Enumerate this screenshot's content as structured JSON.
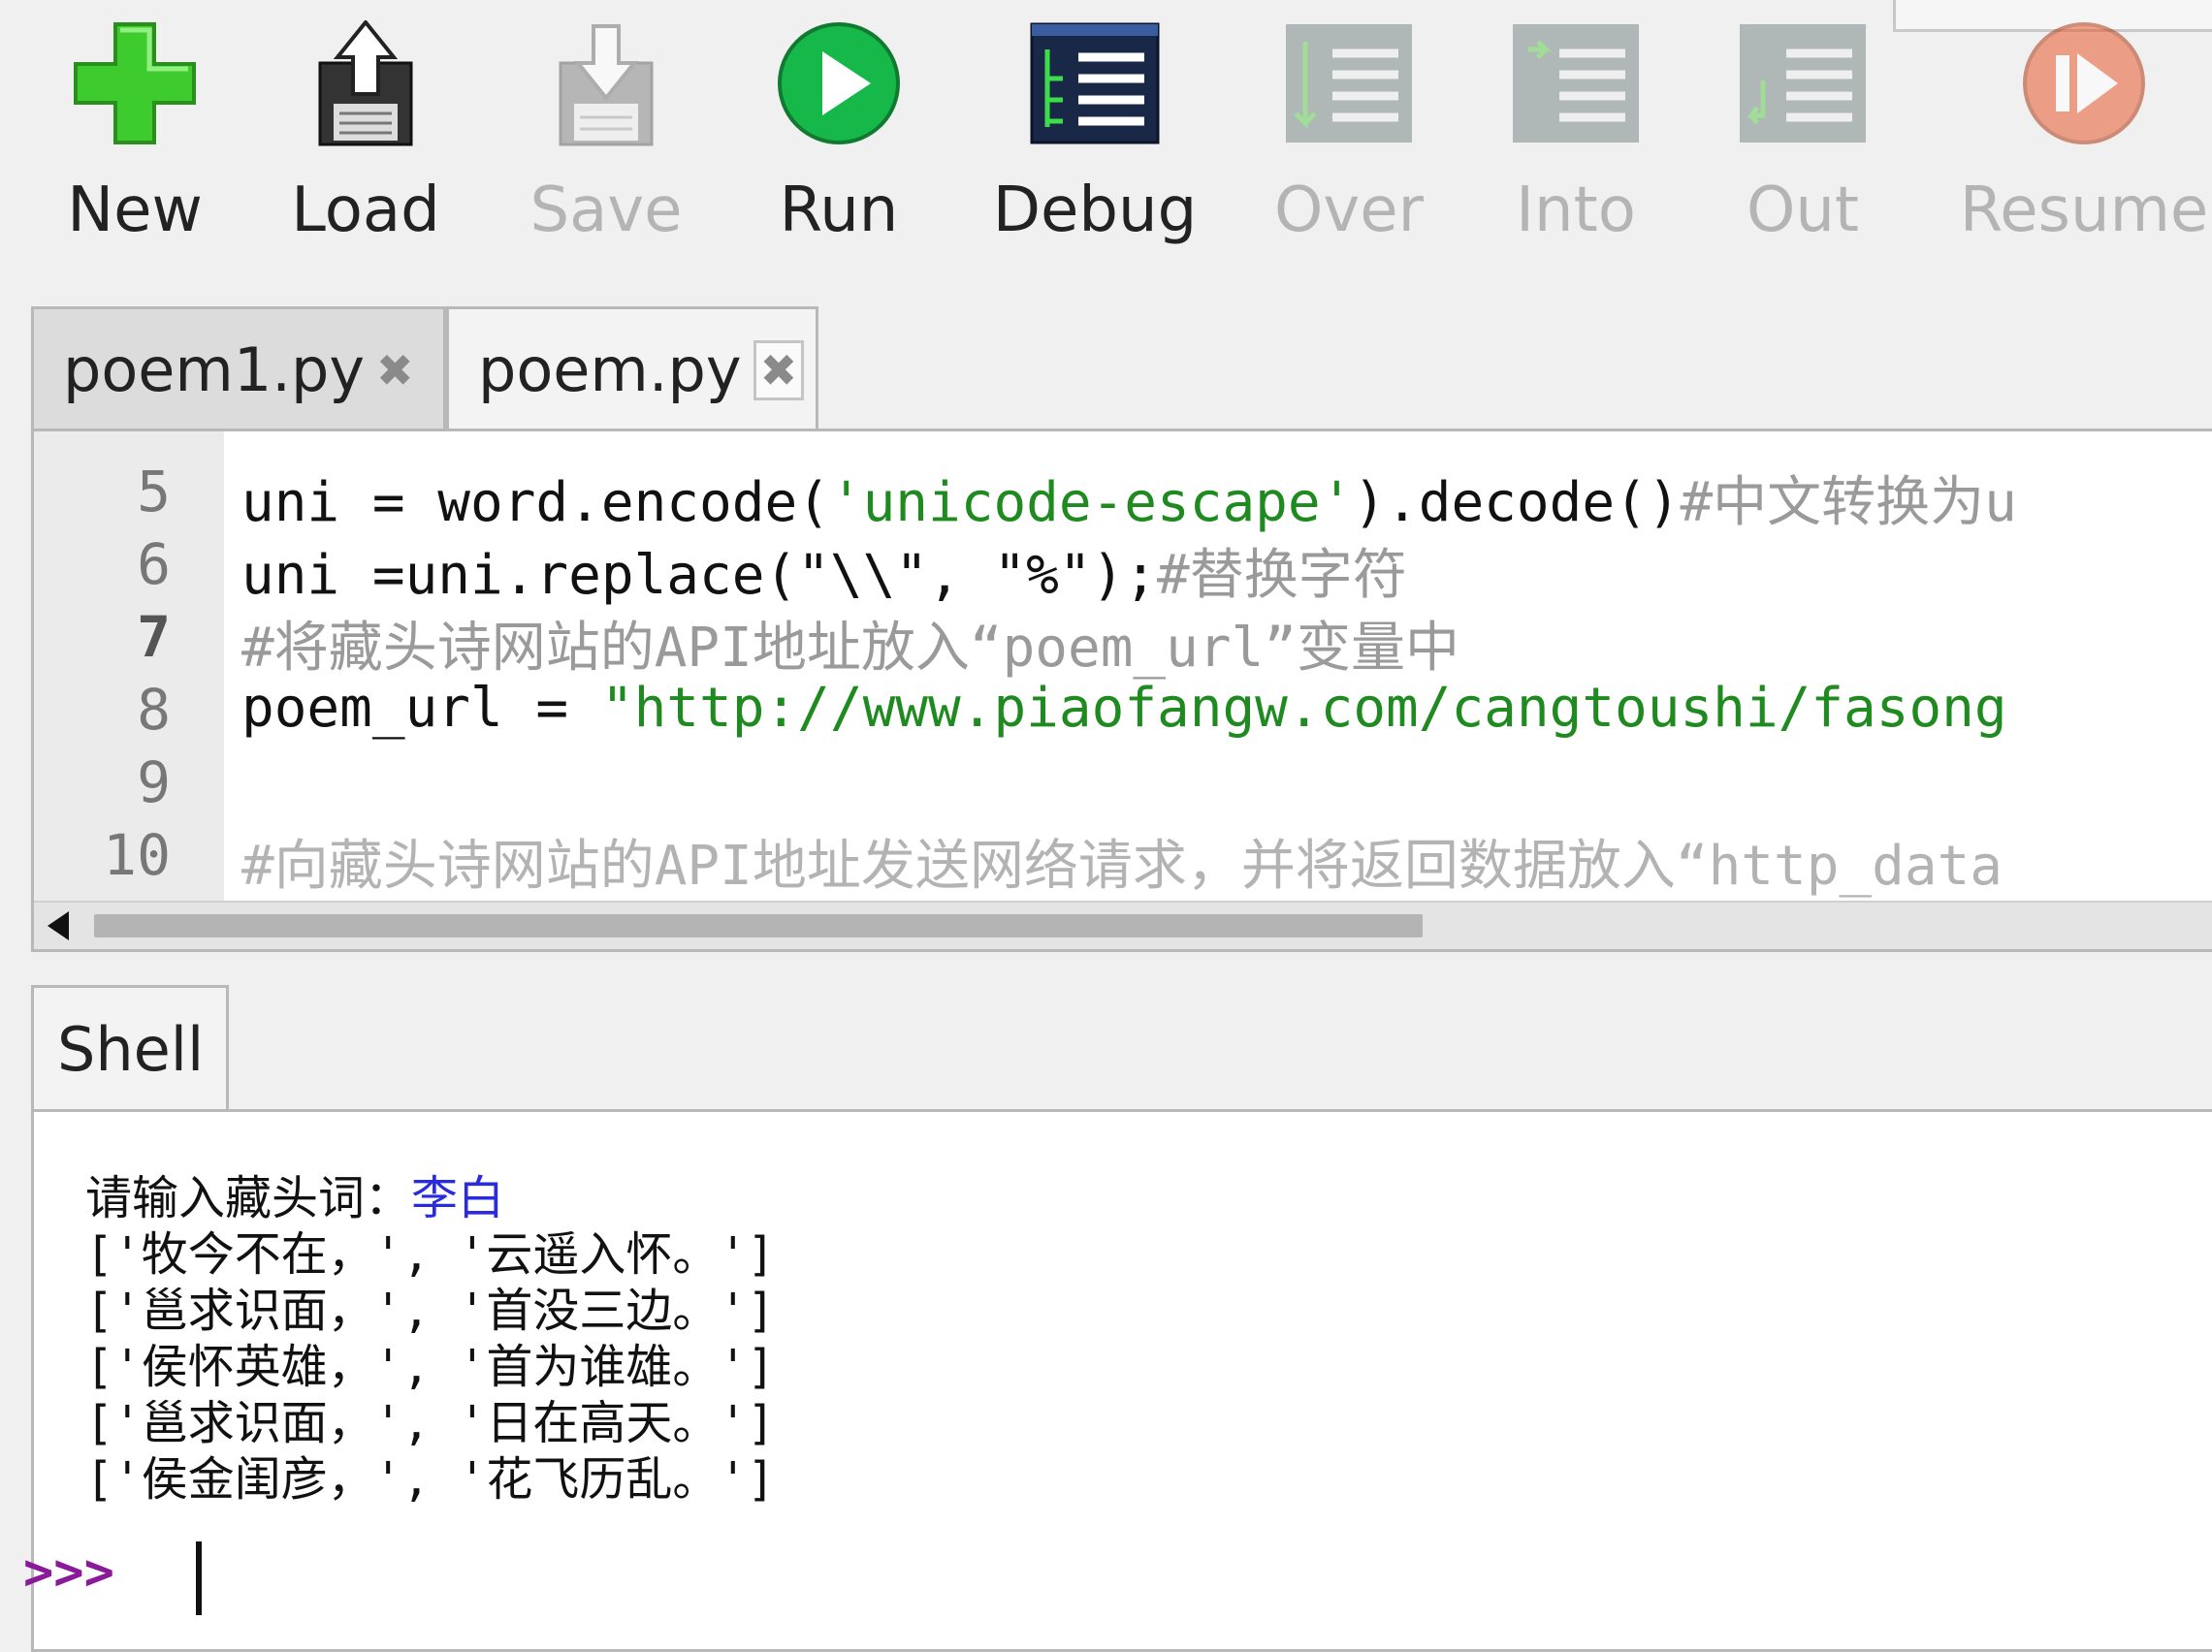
{
  "toolbar": {
    "new_label": "New",
    "load_label": "Load",
    "save_label": "Save",
    "run_label": "Run",
    "debug_label": "Debug",
    "over_label": "Over",
    "into_label": "Into",
    "out_label": "Out",
    "resume_label": "Resume"
  },
  "tabs": [
    {
      "label": "poem1.py",
      "close": "✖"
    },
    {
      "label": "poem.py",
      "close": "✖"
    }
  ],
  "editor": {
    "line_numbers": [
      "5",
      "6",
      "7",
      "8",
      "9",
      "10"
    ],
    "lines": [
      {
        "p1": "uni = word.encode(",
        "p2": "'unicode-escape'",
        "p3": ").decode()",
        "p4": "#中文转换为u"
      },
      {
        "p1": "uni =uni.replace(",
        "p2": "\"\\\\\", \"%\"",
        "p3": ");",
        "p4": "#替换字符"
      },
      {
        "p4": "#将藏头诗网站的API地址放入“poem_url”变量中"
      },
      {
        "p1": "poem_url = ",
        "p2": "\"http://www.piaofangw.com/cangtoushi/fasong"
      },
      {},
      {
        "p4": "#向藏头诗网站的API地址发送网络请求，并将返回数据放入“http_data"
      }
    ]
  },
  "shell": {
    "tab_label": "Shell",
    "input_prompt": "请输入藏头词：",
    "input_value": "李白",
    "outputs": [
      "['牧今不在，', '云遥入怀。']",
      "['邕求识面，', '首没三边。']",
      "['侯怀英雄，', '首为谁雄。']",
      "['邕求识面，', '日在高天。']",
      "['侯金闺彦，', '花飞历乱。']"
    ],
    "prompt": ">>>"
  },
  "colors": {
    "string": "#1f8a1f",
    "comment": "#9a9a9a",
    "shell_input": "#2a2adf",
    "prompt": "#8a1a9a"
  },
  "icons": {
    "new": "plus-icon",
    "load": "load-floppy-icon",
    "save": "save-floppy-icon",
    "run": "play-icon",
    "debug": "debug-list-icon",
    "over": "step-over-icon",
    "into": "step-into-icon",
    "out": "step-out-icon",
    "resume": "resume-icon"
  }
}
